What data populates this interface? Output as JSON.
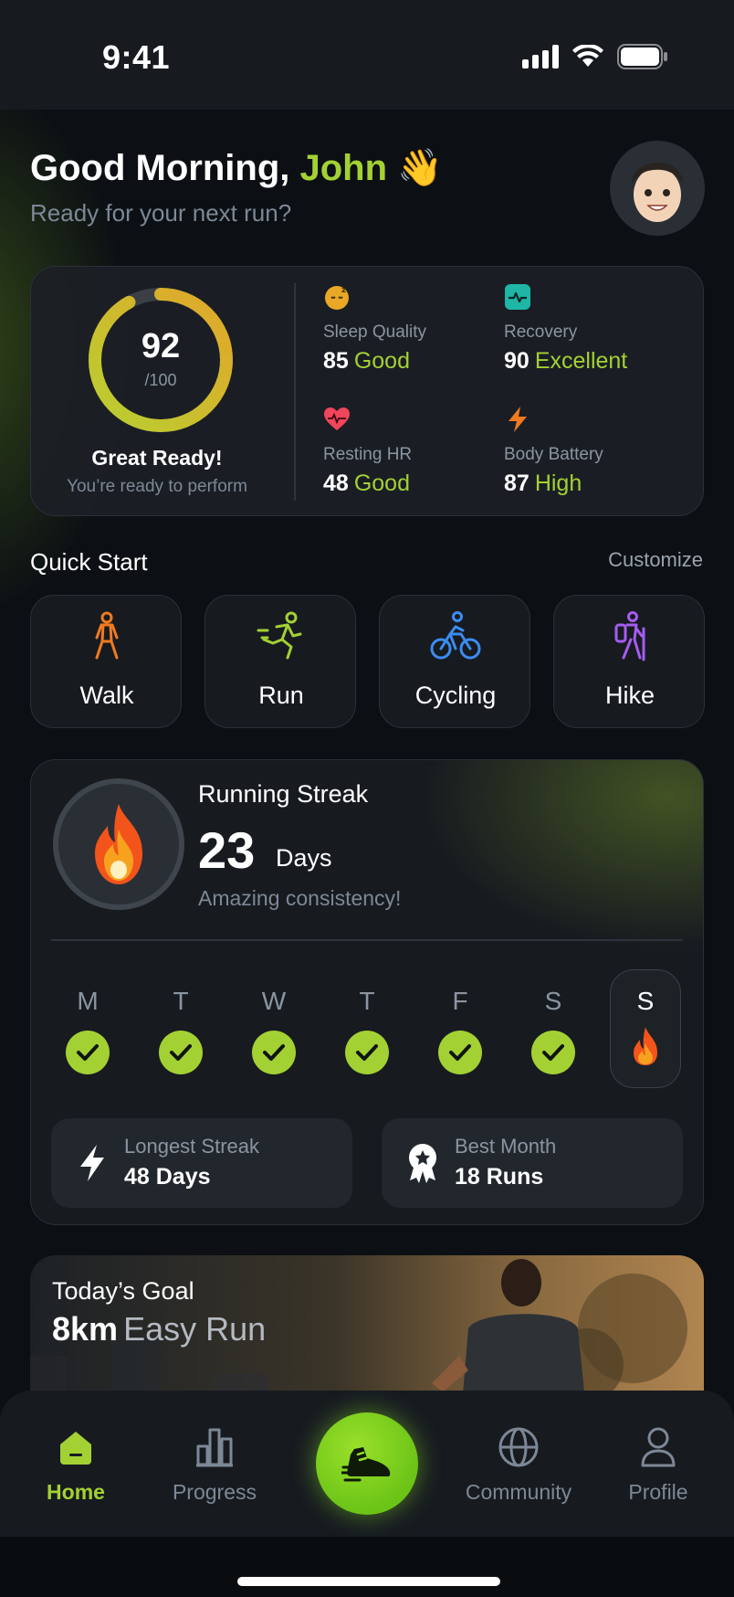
{
  "status_bar": {
    "time": "9:41"
  },
  "header": {
    "greeting_prefix": "Good Morning,",
    "user_name": "John",
    "wave_emoji": "👋",
    "subtitle": "Ready for your next run?"
  },
  "readiness": {
    "score": "92",
    "score_max": "/100",
    "score_fraction": 0.92,
    "title": "Great Ready!",
    "subtitle": "You’re ready to perform",
    "metrics": [
      {
        "icon": "sleep-icon",
        "label": "Sleep Quality",
        "value": "85",
        "status": "Good",
        "color": "#e9a825"
      },
      {
        "icon": "recovery-icon",
        "label": "Recovery",
        "value": "90",
        "status": "Excellent",
        "color": "#1fb6a6"
      },
      {
        "icon": "heart-icon",
        "label": "Resting HR",
        "value": "48",
        "status": "Good",
        "color": "#f0455a"
      },
      {
        "icon": "lightning-icon",
        "label": "Body Battery",
        "value": "87",
        "status": "High",
        "color": "#f07a1f"
      }
    ]
  },
  "quick_start": {
    "title": "Quick Start",
    "customize": "Customize",
    "activities": [
      {
        "label": "Walk",
        "icon": "walk-icon",
        "color": "#f07a1f"
      },
      {
        "label": "Run",
        "icon": "run-icon",
        "color": "#a3d133"
      },
      {
        "label": "Cycling",
        "icon": "cycling-icon",
        "color": "#3b8cf0"
      },
      {
        "label": "Hike",
        "icon": "hike-icon",
        "color": "#a65cf0"
      }
    ]
  },
  "streak": {
    "title": "Running Streak",
    "count": "23",
    "unit": "Days",
    "message": "Amazing consistency!",
    "days": [
      {
        "letter": "M",
        "done": true
      },
      {
        "letter": "T",
        "done": true
      },
      {
        "letter": "W",
        "done": true
      },
      {
        "letter": "T",
        "done": true
      },
      {
        "letter": "F",
        "done": true
      },
      {
        "letter": "S",
        "done": true
      },
      {
        "letter": "S",
        "today": true
      }
    ],
    "longest_label": "Longest Streak",
    "longest_value": "48 Days",
    "best_label": "Best Month",
    "best_value": "18 Runs"
  },
  "goal": {
    "label": "Today’s Goal",
    "distance": "8km",
    "type": "Easy Run"
  },
  "tabbar": {
    "home": "Home",
    "progress": "Progress",
    "community": "Community",
    "profile": "Profile"
  },
  "colors": {
    "accent": "#a3d133",
    "background": "#0c1014",
    "card": "#171b20"
  }
}
